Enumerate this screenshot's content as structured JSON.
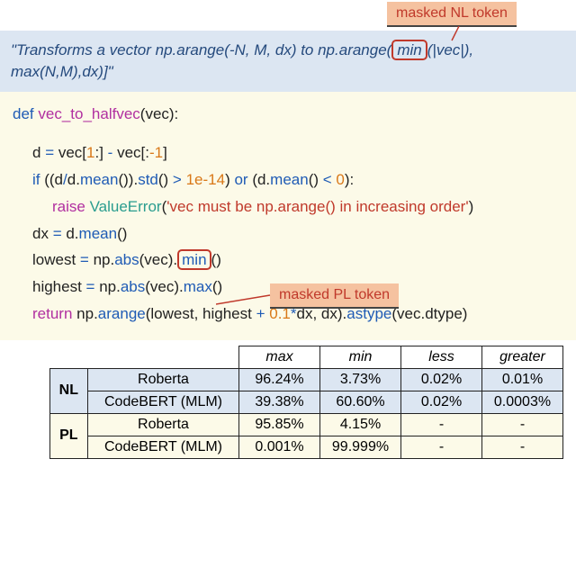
{
  "callouts": {
    "nl": "masked NL token",
    "pl": "masked PL token"
  },
  "natural_language": {
    "pre": "\"Transforms a vector np.arange(-N, M, dx) to np.arange(",
    "masked": "min",
    "post": "(|vec|), max(N,M),dx)]\""
  },
  "code": {
    "def": "def",
    "fn_name": "vec_to_halfvec",
    "fn_sig": "(vec):",
    "slice_line": {
      "pre": "d ",
      "eq": "=",
      "mid": " vec[",
      "one1": "1",
      "c1": ":] ",
      "minus": "-",
      "mid2": " vec[:",
      "negone": "-1",
      "end": "]"
    },
    "if_kw": "if",
    "mean": "mean",
    "std": "std",
    "gt": ">",
    "lt": "<",
    "val_1e14": "1e-14",
    "zero": "0",
    "or_kw": "or",
    "raise_kw": "raise",
    "valueerror": "ValueError",
    "err_str": "'vec must be np.arange() in increasing order'",
    "dx_line": {
      "pre": "dx ",
      "eq": "=",
      "post": " d."
    },
    "lowest_pre": "lowest ",
    "eq": "=",
    "np_abs": "np.",
    "abs": "abs",
    "vec_dot": "(vec).",
    "masked_min": "min",
    "highest_pre": "highest ",
    "max": "max",
    "return_kw": "return",
    "arange": "arange",
    "astype": "astype",
    "coef": "0.1",
    "star": "*",
    "plus": "+",
    "ret_tail": "(lowest, highest ",
    "ret_tail2": "dx, dx).",
    "ret_tail3": "(vec.dtype)"
  },
  "chart_data": {
    "type": "table",
    "columns": [
      "max",
      "min",
      "less",
      "greater"
    ],
    "groups": [
      {
        "name": "NL",
        "rows": [
          {
            "model": "Roberta",
            "values": [
              "96.24%",
              "3.73%",
              "0.02%",
              "0.01%"
            ]
          },
          {
            "model": "CodeBERT (MLM)",
            "values": [
              "39.38%",
              "60.60%",
              "0.02%",
              "0.0003%"
            ]
          }
        ]
      },
      {
        "name": "PL",
        "rows": [
          {
            "model": "Roberta",
            "values": [
              "95.85%",
              "4.15%",
              "-",
              "-"
            ]
          },
          {
            "model": "CodeBERT (MLM)",
            "values": [
              "0.001%",
              "99.999%",
              "-",
              "-"
            ]
          }
        ]
      }
    ]
  }
}
